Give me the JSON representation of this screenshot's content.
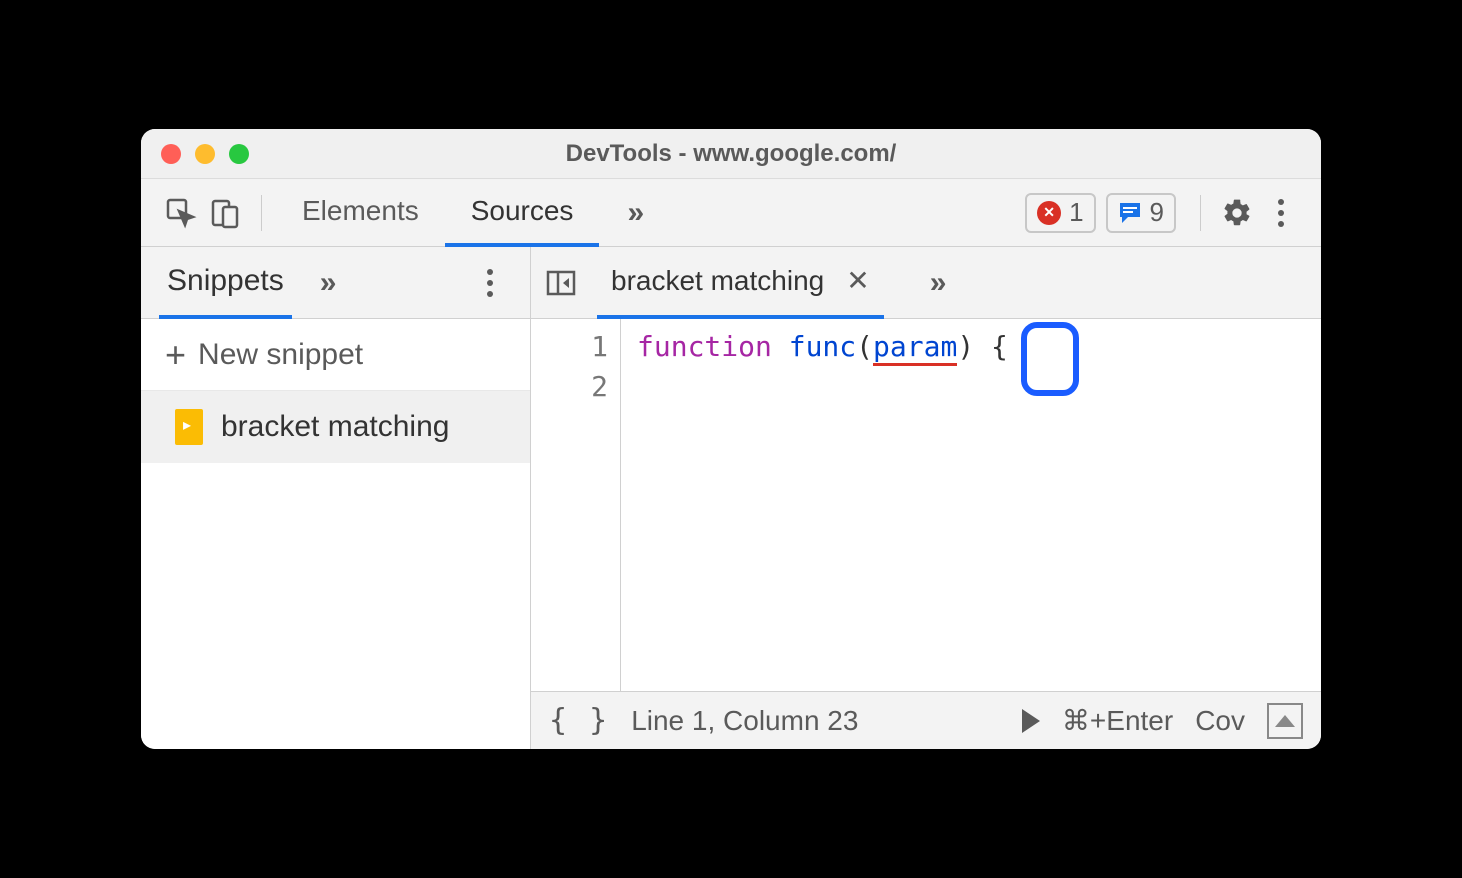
{
  "window": {
    "title": "DevTools - www.google.com/"
  },
  "main_toolbar": {
    "tabs": [
      {
        "label": "Elements"
      },
      {
        "label": "Sources"
      }
    ],
    "active_tab": "Sources",
    "error_count": "1",
    "message_count": "9"
  },
  "sidebar": {
    "tab_label": "Snippets",
    "new_snippet_label": "New snippet",
    "items": [
      {
        "label": "bracket matching"
      }
    ]
  },
  "editor": {
    "tab_label": "bracket matching",
    "line_numbers": [
      "1",
      "2"
    ],
    "code": {
      "keyword": "function",
      "func_name": "func",
      "open_paren": "(",
      "param": "param",
      "close_paren": ")",
      "brace": "{"
    }
  },
  "statusbar": {
    "position": "Line 1, Column 23",
    "run_shortcut": "⌘+Enter",
    "coverage": "Cov"
  }
}
